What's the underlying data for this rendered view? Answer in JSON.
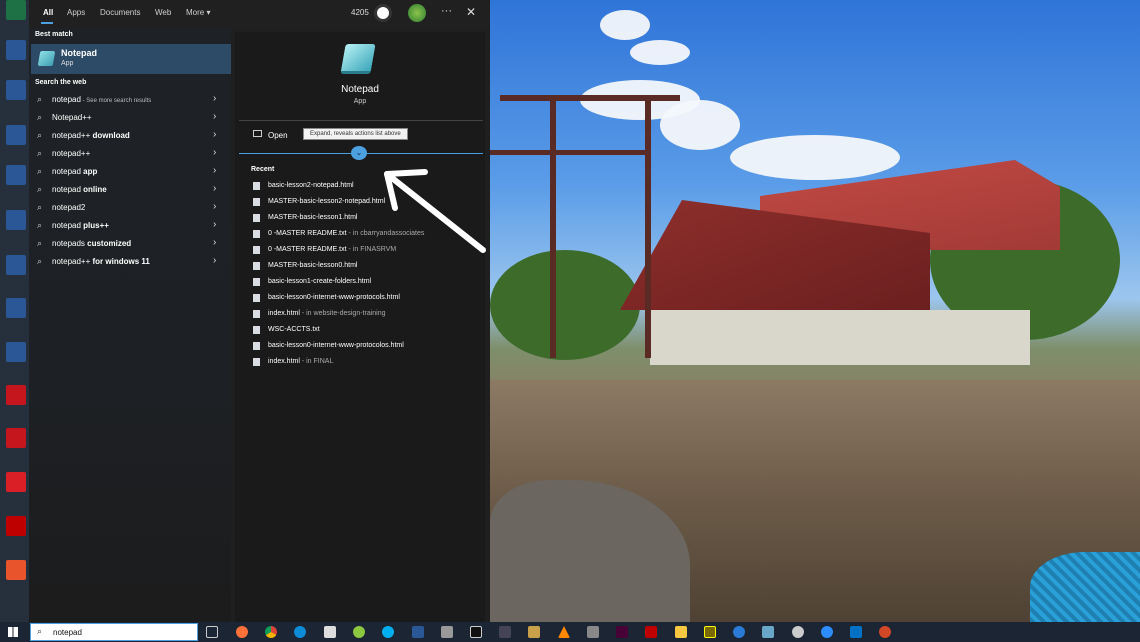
{
  "search_tabs": {
    "all": "All",
    "apps": "Apps",
    "documents": "Documents",
    "web": "Web",
    "more": "More ▾"
  },
  "header": {
    "points": "4205",
    "more_options": "···",
    "close": "✕"
  },
  "best_match": {
    "section": "Best match",
    "title": "Notepad",
    "subtitle": "App"
  },
  "web_search": {
    "section": "Search the web",
    "results": [
      {
        "plain": "notepad",
        "bold": "",
        "hint": " - See more search results"
      },
      {
        "plain": "Notepad++",
        "bold": "",
        "hint": ""
      },
      {
        "plain": "notepad++ ",
        "bold": "download",
        "hint": ""
      },
      {
        "plain": "notepad++",
        "bold": "",
        "hint": ""
      },
      {
        "plain": "notepad ",
        "bold": "app",
        "hint": ""
      },
      {
        "plain": "notepad ",
        "bold": "online",
        "hint": ""
      },
      {
        "plain": "notepad2",
        "bold": "",
        "hint": ""
      },
      {
        "plain": "notepad ",
        "bold": "plus++",
        "hint": ""
      },
      {
        "plain": "notepads ",
        "bold": "customized",
        "hint": ""
      },
      {
        "plain": "notepad++ ",
        "bold": "for windows 11",
        "hint": ""
      }
    ]
  },
  "preview": {
    "name": "Notepad",
    "type": "App",
    "open_label": "Open",
    "tooltip": "Expand, reveals actions list above",
    "recent_title": "Recent",
    "recent": [
      {
        "name": "basic-lesson2-notepad.html",
        "loc": ""
      },
      {
        "name": "MASTER-basic-lesson2-notepad.html",
        "loc": ""
      },
      {
        "name": "MASTER-basic-lesson1.html",
        "loc": ""
      },
      {
        "name": "0 -MASTER README.txt",
        "loc": " - in cbarryandassociates"
      },
      {
        "name": "0 -MASTER README.txt",
        "loc": " - in FINASRVM"
      },
      {
        "name": "MASTER-basic-lesson0.html",
        "loc": ""
      },
      {
        "name": "basic-lesson1-create-folders.html",
        "loc": ""
      },
      {
        "name": "basic-lesson0-internet-www-protocols.html",
        "loc": ""
      },
      {
        "name": "index.html",
        "loc": " - in website-design-training"
      },
      {
        "name": "WSC-ACCTS.txt",
        "loc": ""
      },
      {
        "name": "basic-lesson0-internet-www-protocolos.html",
        "loc": ""
      },
      {
        "name": "index.html",
        "loc": " - in FINAL"
      }
    ]
  },
  "taskbar": {
    "search_value": "notepad"
  },
  "colors": {
    "accent": "#4ca0e0",
    "best_match_bg": "#2d4a66",
    "panel_bg": "#1f1f1f"
  }
}
